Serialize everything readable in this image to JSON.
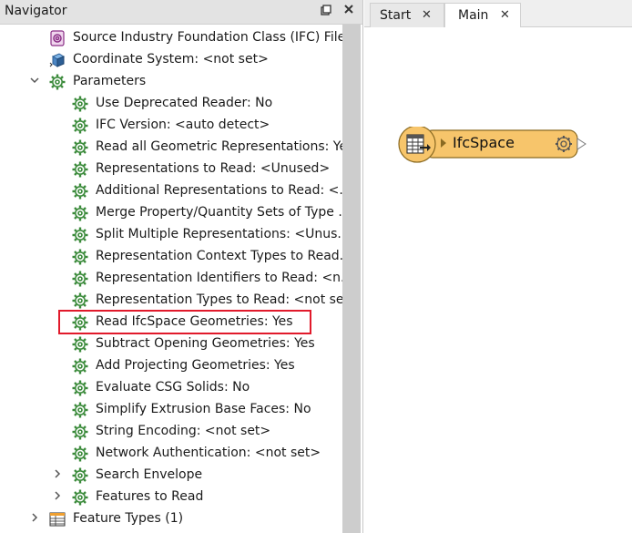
{
  "navigator": {
    "title": "Navigator",
    "pin_icon": "pin-icon",
    "close_icon": "close-icon",
    "items": [
      {
        "label": "Source Industry Foundation Class (IFC) File...",
        "icon": "source-dataset-icon",
        "level": 1,
        "expander": ""
      },
      {
        "label": "Coordinate System: <not set>",
        "icon": "coordinate-system-icon",
        "level": 1,
        "expander": ""
      },
      {
        "label": "Parameters",
        "icon": "gear-icon",
        "level": 0,
        "expander": "expanded"
      },
      {
        "label": "Use Deprecated Reader: No",
        "icon": "gear-icon",
        "level": 2,
        "expander": ""
      },
      {
        "label": "IFC Version: <auto detect>",
        "icon": "gear-icon",
        "level": 2,
        "expander": ""
      },
      {
        "label": "Read all Geometric Representations: Yes",
        "icon": "gear-icon",
        "level": 2,
        "expander": ""
      },
      {
        "label": "Representations to Read: <Unused>",
        "icon": "gear-icon",
        "level": 2,
        "expander": ""
      },
      {
        "label": "Additional Representations to Read: <...",
        "icon": "gear-icon",
        "level": 2,
        "expander": ""
      },
      {
        "label": "Merge Property/Quantity Sets of Type ...",
        "icon": "gear-icon",
        "level": 2,
        "expander": ""
      },
      {
        "label": "Split Multiple Representations: <Unus...",
        "icon": "gear-icon",
        "level": 2,
        "expander": ""
      },
      {
        "label": "Representation Context Types to Read...",
        "icon": "gear-icon",
        "level": 2,
        "expander": ""
      },
      {
        "label": "Representation Identifiers to Read: <n...",
        "icon": "gear-icon",
        "level": 2,
        "expander": ""
      },
      {
        "label": "Representation Types to Read: <not se...",
        "icon": "gear-icon",
        "level": 2,
        "expander": ""
      },
      {
        "label": "Read IfcSpace Geometries: Yes",
        "icon": "gear-icon",
        "level": 2,
        "expander": "",
        "highlighted": true
      },
      {
        "label": "Subtract Opening Geometries: Yes",
        "icon": "gear-icon",
        "level": 2,
        "expander": ""
      },
      {
        "label": "Add Projecting Geometries: Yes",
        "icon": "gear-icon",
        "level": 2,
        "expander": ""
      },
      {
        "label": "Evaluate CSG Solids: No",
        "icon": "gear-icon",
        "level": 2,
        "expander": ""
      },
      {
        "label": "Simplify Extrusion Base Faces: No",
        "icon": "gear-icon",
        "level": 2,
        "expander": ""
      },
      {
        "label": "String Encoding: <not set>",
        "icon": "gear-icon",
        "level": 2,
        "expander": ""
      },
      {
        "label": "Network Authentication: <not set>",
        "icon": "gear-icon",
        "level": 2,
        "expander": ""
      },
      {
        "label": "Search Envelope",
        "icon": "gear-icon",
        "level": 2,
        "expander": "collapsed"
      },
      {
        "label": "Features to Read",
        "icon": "gear-icon",
        "level": 2,
        "expander": "collapsed"
      },
      {
        "label": "Feature Types (1)",
        "icon": "feature-types-icon",
        "level": 1,
        "expander": "collapsed"
      }
    ]
  },
  "tabs": [
    {
      "label": "Start",
      "close": "✕",
      "active": false
    },
    {
      "label": "Main",
      "close": "✕",
      "active": true
    }
  ],
  "canvas": {
    "node": {
      "label": "IfcSpace",
      "fill": "#f7c56b",
      "border": "#a07a2a",
      "icon": "reader-table-icon",
      "settings_icon": "gear-icon"
    }
  },
  "colors": {
    "highlight_box": "#e11a2b",
    "gear_green": "#3a8a3a"
  }
}
